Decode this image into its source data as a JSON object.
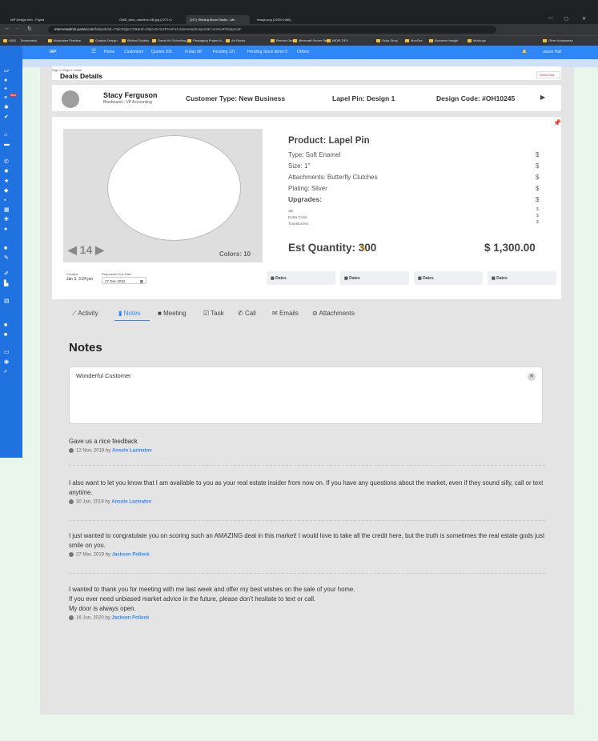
{
  "browser": {
    "tabs": [
      {
        "label": "IAP Design Info - Figma",
        "active": false
      },
      {
        "label": "GMB_claw_machine-DB.jpg (1271×1",
        "active": false
      },
      {
        "label": "(217) Shining Moon Studio - Mu",
        "active": true
      },
      {
        "label": "image.png (1920×1080)",
        "active": false
      }
    ],
    "url": "internetadmin.portal.com",
    "url_path": "/fullpath/tid=73dc03gKCR9&ref=http%3A%2F%2Fu3.internetadminportal.com%2Ffriday%2F",
    "bookmarks": [
      "SMG",
      "Bookmarks",
      "Illustration Practice",
      "Graphic Design",
      "Biblical Studies",
      "Game Art Schooling",
      "Packaging Project A...",
      "Art Books",
      "Render Dev",
      "Minecraft Server Se...",
      "INDIE DEV",
      "Soda Shop",
      "MonDev",
      "Business Insight",
      "Mockups",
      "Other bookmarks"
    ]
  },
  "nav": {
    "brand": "IAP",
    "items": [
      "Home",
      "Customers",
      "Quotes 106",
      "Friday 68",
      "Pending 121",
      "Pending Stock Items 0",
      "Orders"
    ],
    "user": "Jason Hall"
  },
  "sidebar": {
    "label": "IAP"
  },
  "page": {
    "breadcrumb": "Page 1 / Page 2 / Detail",
    "title": "Deals Details",
    "delete_label": "Delete Deal"
  },
  "customer": {
    "name": "Stacy Ferguson",
    "company": "Bluebound - VP Accounting",
    "type": "Customer Type: New Business",
    "pin": "Lapel Pin: Design 1",
    "code": "Design Code: #OH10245"
  },
  "product": {
    "title": "Product: Lapel Pin",
    "specs": [
      "Type: Soft Enamel",
      "Size: 1\"",
      "Attachments: Butterfly Clutches",
      "Plating: Silver"
    ],
    "price_symbol": "$",
    "upgrades_label": "Upgrades:",
    "upgrades": [
      "3D",
      "Extra Color",
      "Translucent"
    ],
    "count": "14",
    "colors": "Colors: 10",
    "est_quantity": "Est Quantity: 300",
    "total": "$ 1,300.00"
  },
  "dates": {
    "created_label": "Created",
    "created": "Jan 3, 3:24 pm",
    "requested_label": "Requested Due Date",
    "requested": "27 Dec 2022",
    "buttons": [
      "Dates",
      "Dates",
      "Dates",
      "Dates"
    ]
  },
  "tabs": [
    "Activity",
    "Notes",
    "Meeting",
    "Task",
    "Call",
    "Emails",
    "Attachments"
  ],
  "notes": {
    "heading": "Notes",
    "input_value": "Wonderful Customer",
    "items": [
      {
        "text": "Gave us a nice feedback",
        "date": "12 Nov, 2018 by",
        "author": "Ansolo Lazinatov"
      },
      {
        "text": "I also want to let you know that I am available to you as your real estate insider from now on. If you have any questions about the market, even if they sound silly, call or text anytime.",
        "date": "30 Jan, 2019 by",
        "author": "Ansolo Lazinatov"
      },
      {
        "text": "I just wanted to congratulate you on scoring such an AMAZING deal in this market! I would love to take all the credit here, but the truth is sometimes the real estate gods just smile on you.",
        "date": "27 Mar, 2019 by",
        "author": "Jackson Pollock"
      },
      {
        "text": "I wanted to thank you for meeting with me last week and offer my best wishes on the sale of your home.\nIf you ever need unbiased market advice in the future, please don’t hesitate to text or call.\nMy door is always open.",
        "date": "16 Jun, 2020 by",
        "author": "Jackson Pollock"
      }
    ]
  }
}
